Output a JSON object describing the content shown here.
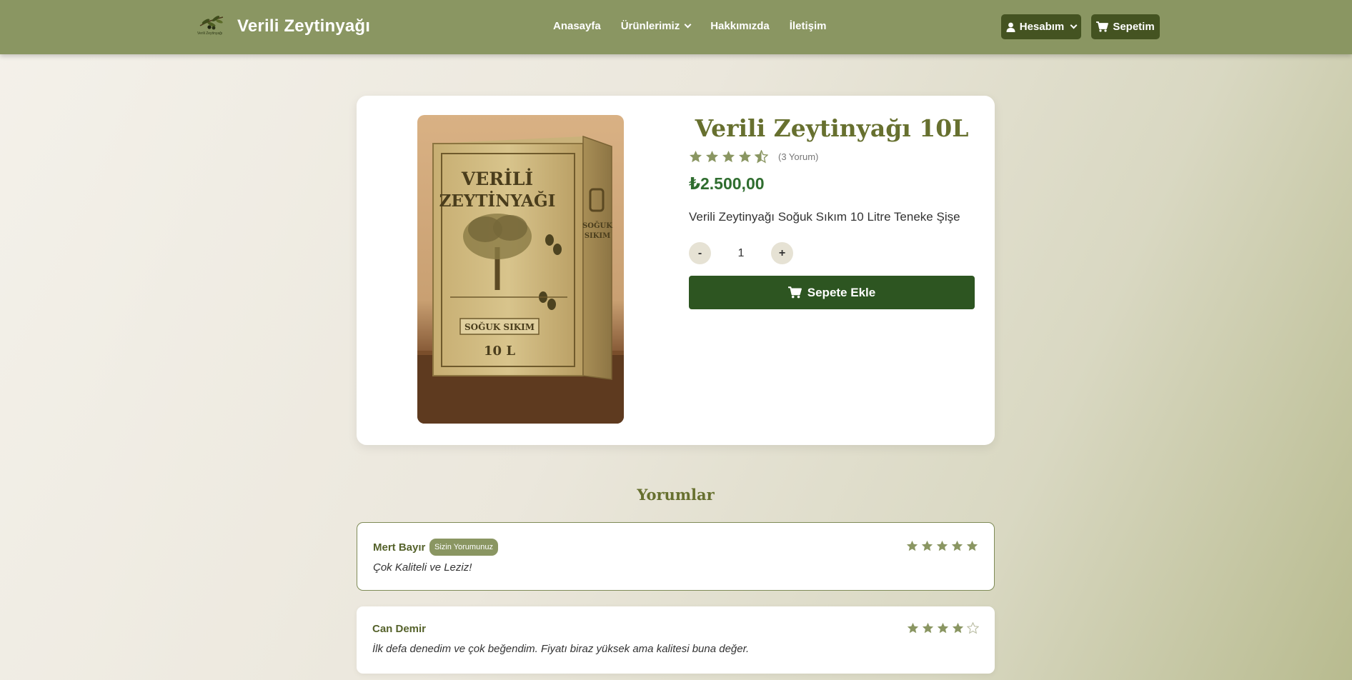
{
  "navbar": {
    "brand_name": "Verili Zeytinyağı",
    "logo_text": "Verili Zeytinyağı",
    "links": [
      "Anasayfa",
      "Ürünlerimiz",
      "Hakkımızda",
      "İletişim"
    ],
    "account_label": "Hesabım",
    "cart_label": "Sepetim",
    "colors": {
      "bar": "#8a9662",
      "button": "#445321"
    }
  },
  "product": {
    "title": "Verili Zeytinyağı 10L",
    "rating": 4.5,
    "review_count": "(3 Yorum)",
    "price": "₺2.500,00",
    "description": "Verili Zeytinyağı Soğuk Sıkım 10 Litre Teneke Şişe",
    "quantity": "1",
    "minus_label": "-",
    "plus_label": "+",
    "add_to_cart_label": "Sepete Ekle",
    "image": {
      "line1": "VERİLİ",
      "line2": "ZEYTİNYAĞI",
      "side1": "SOĞUK",
      "side2": "SIKIM",
      "band": "SOĞUK SIKIM",
      "volume": "10 L"
    },
    "colors": {
      "title": "#67702f",
      "price": "#2f6d2f",
      "button": "#2d5521",
      "star": "#8a9662"
    }
  },
  "reviews": {
    "title": "Yorumlar",
    "items": [
      {
        "author": "Mert Bayır",
        "badge": "Sizin Yorumunuz",
        "rating": 5,
        "text": "Çok Kaliteli ve Leziz!"
      },
      {
        "author": "Can Demir",
        "badge": "",
        "rating": 4,
        "text": "İlk defa denedim ve çok beğendim. Fiyatı biraz yüksek ama kalitesi buna değer."
      }
    ]
  }
}
